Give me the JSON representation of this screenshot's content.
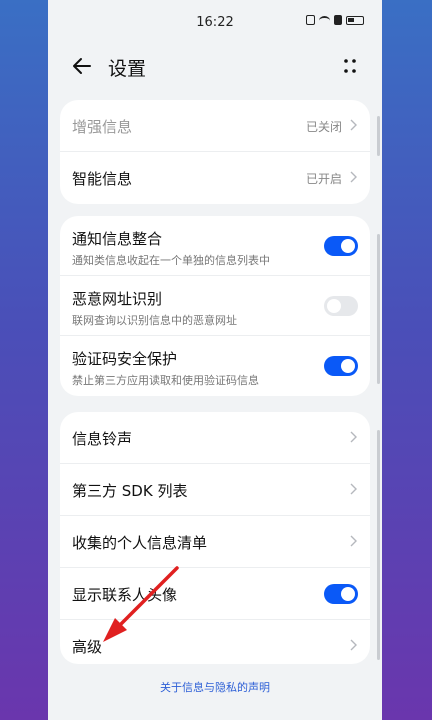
{
  "status": {
    "time": "16:22"
  },
  "header": {
    "title": "设置"
  },
  "group1": {
    "items": [
      {
        "label": "增强信息",
        "value": "已关闭"
      },
      {
        "label": "智能信息",
        "value": "已开启"
      }
    ]
  },
  "group2": {
    "items": [
      {
        "label": "通知信息整合",
        "desc": "通知类信息收起在一个单独的信息列表中",
        "on": true
      },
      {
        "label": "恶意网址识别",
        "desc": "联网查询以识别信息中的恶意网址",
        "on": false
      },
      {
        "label": "验证码安全保护",
        "desc": "禁止第三方应用读取和使用验证码信息",
        "on": true
      }
    ]
  },
  "group3": {
    "items": [
      {
        "label": "信息铃声"
      },
      {
        "label": "第三方 SDK 列表"
      },
      {
        "label": "收集的个人信息清单"
      },
      {
        "label": "显示联系人头像",
        "on": true
      },
      {
        "label": "高级"
      }
    ]
  },
  "footer": {
    "link": "关于信息与隐私的声明"
  },
  "colors": {
    "accent": "#0a59f7",
    "annotation_arrow": "#e02020"
  }
}
